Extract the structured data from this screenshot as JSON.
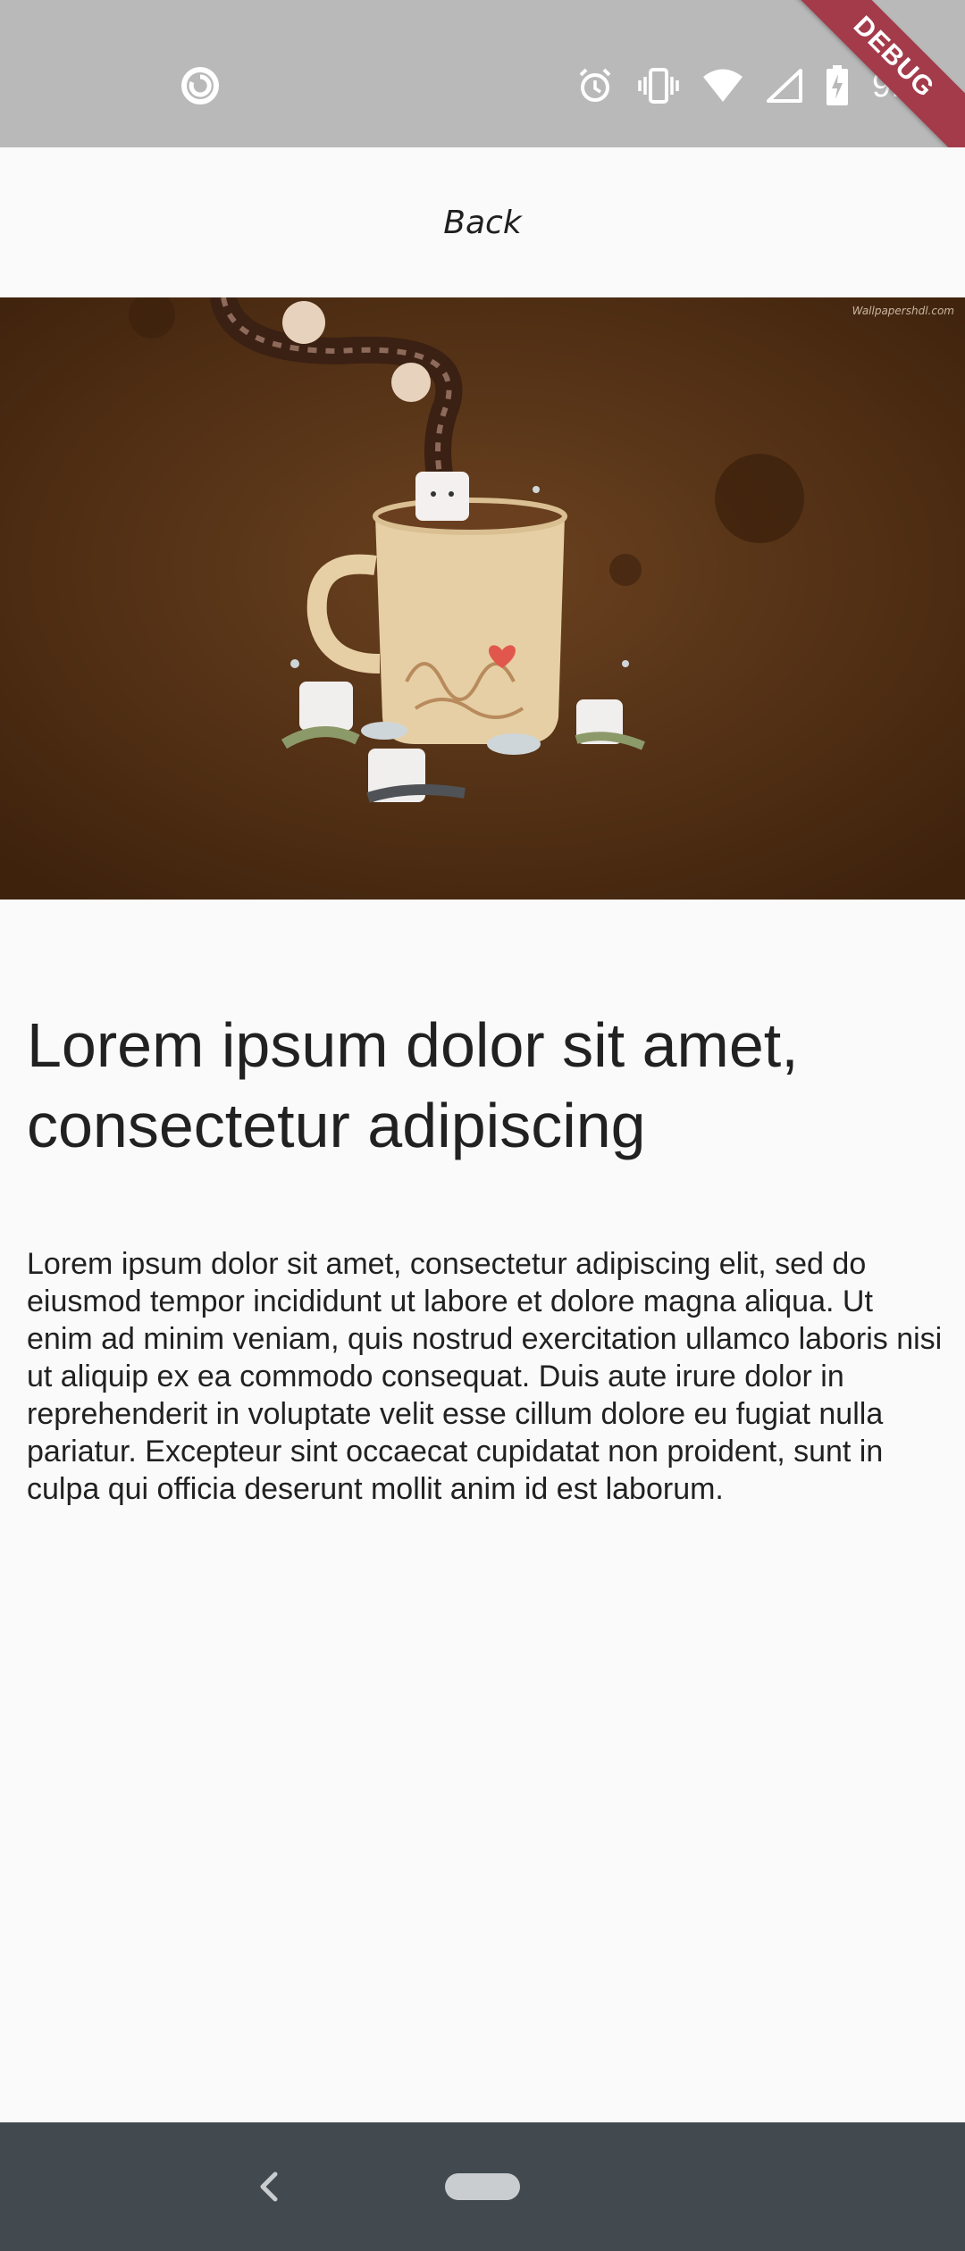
{
  "status_bar": {
    "time": "9:16",
    "debug_banner": "DEBUG",
    "icons": [
      "app-notification-icon",
      "alarm-icon",
      "vibrate-icon",
      "wifi-icon",
      "signal-icon",
      "battery-charging-icon"
    ]
  },
  "app_bar": {
    "back_label": "Back"
  },
  "hero_image": {
    "description": "hot-cocoa-mug-with-marshmallows",
    "watermark": "Wallpapershdl.com",
    "colors": {
      "background": "#5a3516",
      "mug": "#e6cfa5",
      "heart": "#e2574c"
    }
  },
  "content": {
    "title": "Lorem ipsum dolor sit amet, consectetur adipiscing",
    "body": "Lorem ipsum dolor sit amet, consectetur adipiscing elit, sed do eiusmod tempor incididunt ut labore et dolore magna aliqua. Ut enim ad minim veniam, quis nostrud exercitation ullamco laboris nisi ut aliquip ex ea commodo consequat. Duis aute irure dolor in reprehenderit in voluptate velit esse cillum dolore eu fugiat nulla pariatur. Excepteur sint occaecat cupidatat non proident, sunt in culpa qui officia deserunt mollit anim id est laborum."
  },
  "nav_bar": {
    "icons": [
      "nav-back-icon",
      "home-pill-icon"
    ]
  }
}
